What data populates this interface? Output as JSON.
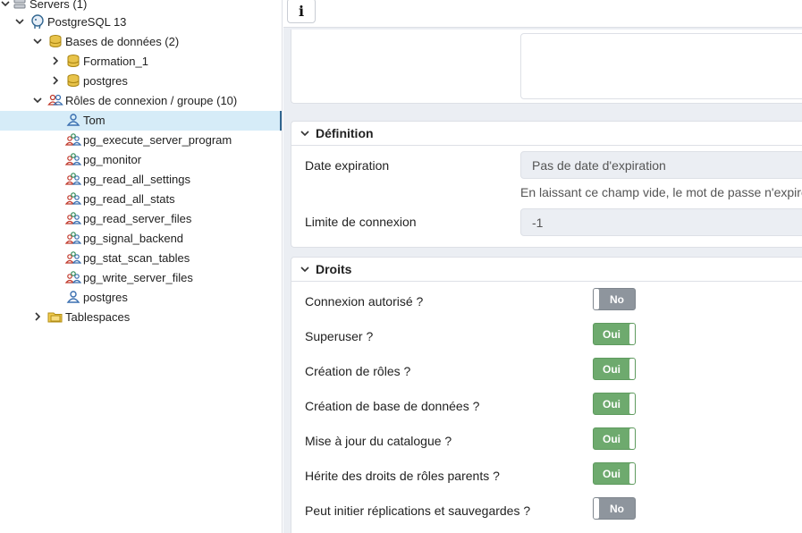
{
  "tree": {
    "servers": "Servers (1)",
    "server": "PostgreSQL 13",
    "databases_group": "Bases de données (2)",
    "db1": "Formation_1",
    "db2": "postgres",
    "roles_group": "Rôles de connexion / groupe (10)",
    "roles": [
      "Tom",
      "pg_execute_server_program",
      "pg_monitor",
      "pg_read_all_settings",
      "pg_read_all_stats",
      "pg_read_server_files",
      "pg_signal_backend",
      "pg_stat_scan_tables",
      "pg_write_server_files",
      "postgres"
    ],
    "tablespaces": "Tablespaces"
  },
  "toolbar": {
    "info_label": "i"
  },
  "definition": {
    "title": "Définition",
    "expiry_label": "Date expiration",
    "expiry_placeholder": "Pas de date d'expiration",
    "expiry_help": "En laissant ce champ vide, le mot de passe n'expirera jamais.",
    "conn_limit_label": "Limite de connexion",
    "conn_limit_value": "-1"
  },
  "droits": {
    "title": "Droits",
    "items": [
      {
        "label": "Connexion autorisé ?",
        "state": "No"
      },
      {
        "label": "Superuser ?",
        "state": "Oui"
      },
      {
        "label": "Création de rôles ?",
        "state": "Oui"
      },
      {
        "label": "Création de base de données ?",
        "state": "Oui"
      },
      {
        "label": "Mise à jour du catalogue ?",
        "state": "Oui"
      },
      {
        "label": "Hérite des droits de rôles parents ?",
        "state": "Oui"
      },
      {
        "label": "Peut initier réplications et sauvegardes ?",
        "state": "No"
      }
    ]
  },
  "colors": {
    "toggle_on": "#6eaa6e",
    "toggle_off": "#8e959d",
    "selection": "#d6ecf8",
    "selection_bar": "#326690"
  }
}
